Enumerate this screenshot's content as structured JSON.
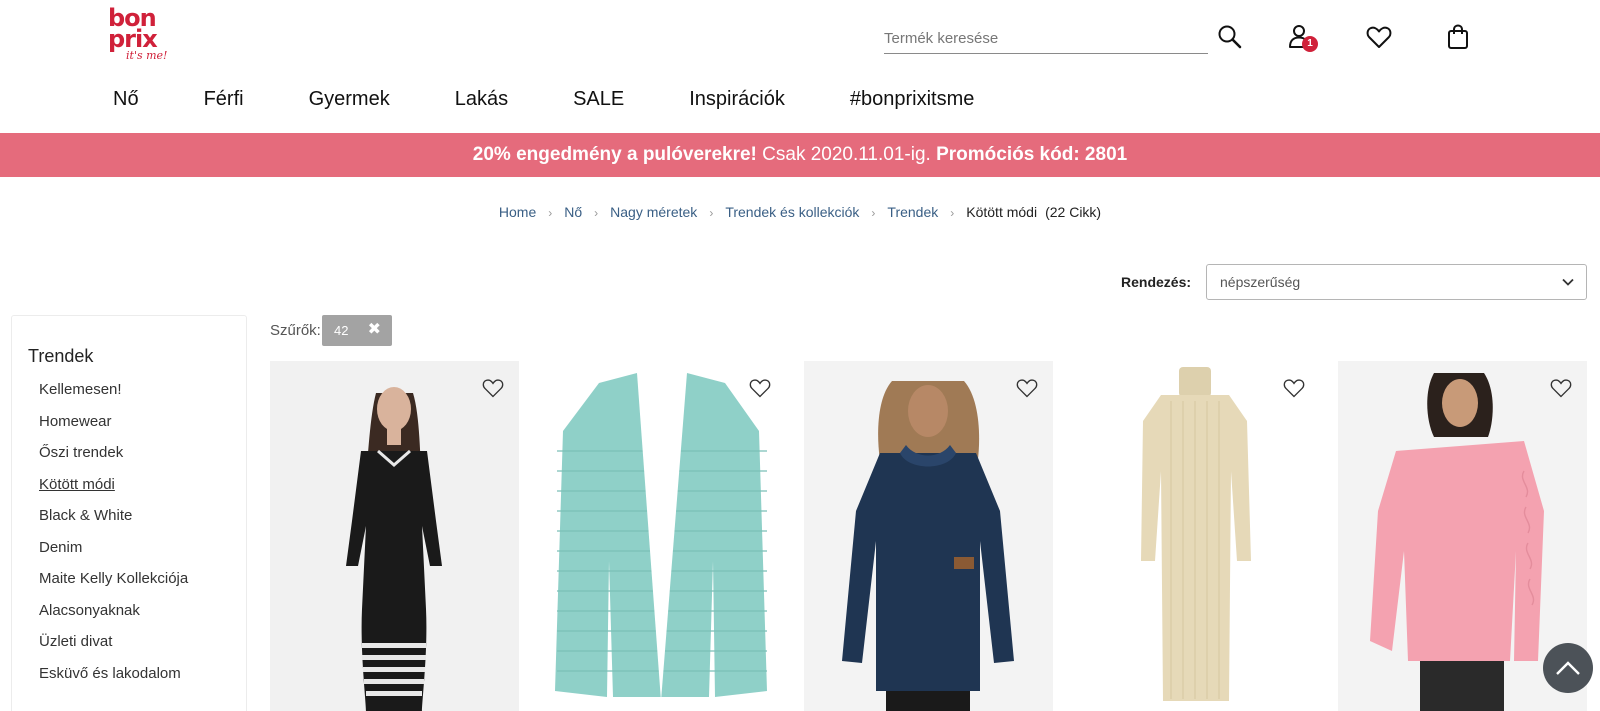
{
  "header": {
    "logo": {
      "line1": "bon",
      "line2": "prix",
      "tagline": "it's me!"
    },
    "search": {
      "placeholder": "Termék keresése",
      "value": ""
    },
    "account_badge": "1"
  },
  "nav": {
    "items": [
      {
        "label": "Nő"
      },
      {
        "label": "Férfi"
      },
      {
        "label": "Gyermek"
      },
      {
        "label": "Lakás"
      },
      {
        "label": "SALE"
      },
      {
        "label": "Inspirációk"
      },
      {
        "label": "#bonprixitsme"
      }
    ]
  },
  "promo": {
    "bold_text": "20% engedmény a pulóverekre!",
    "normal_text": " Csak 2020.11.01-ig. ",
    "code_text": "Promóciós kód: 2801",
    "background": "#e56b7c"
  },
  "breadcrumb": {
    "items": [
      {
        "label": "Home"
      },
      {
        "label": "Nő"
      },
      {
        "label": "Nagy méretek"
      },
      {
        "label": "Trendek és kollekciók"
      },
      {
        "label": "Trendek"
      }
    ],
    "current": "Kötött módi",
    "count": "(22 Cikk)"
  },
  "sort": {
    "label": "Rendezés:",
    "value": "népszerűség"
  },
  "sidebar": {
    "title": "Trendek",
    "items": [
      {
        "label": "Kellemesen!",
        "active": false
      },
      {
        "label": "Homewear",
        "active": false
      },
      {
        "label": "Őszi trendek",
        "active": false
      },
      {
        "label": "Kötött módi",
        "active": true
      },
      {
        "label": "Black & White",
        "active": false
      },
      {
        "label": "Denim",
        "active": false
      },
      {
        "label": "Maite Kelly Kollekciója",
        "active": false
      },
      {
        "label": "Alacsonyaknak",
        "active": false
      },
      {
        "label": "Üzleti divat",
        "active": false
      },
      {
        "label": "Esküvő és lakodalom",
        "active": false
      }
    ]
  },
  "filters": {
    "label": "Szűrők:",
    "chips": [
      {
        "value": "42"
      }
    ]
  },
  "products": [
    {
      "name": "black-striped-knit-dress",
      "color": "#1a1a1a",
      "bg": "#f1f1f1"
    },
    {
      "name": "mint-knit-cardigan",
      "color": "#8fd0c8",
      "bg": "#ffffff"
    },
    {
      "name": "navy-wrap-sweater",
      "color": "#1f3552",
      "bg": "#f3f3f3"
    },
    {
      "name": "beige-turtleneck-dress",
      "color": "#e6d9b8",
      "bg": "#ffffff"
    },
    {
      "name": "pink-oversized-sweater",
      "color": "#f4a2b0",
      "bg": "#f3f3f3"
    }
  ]
}
